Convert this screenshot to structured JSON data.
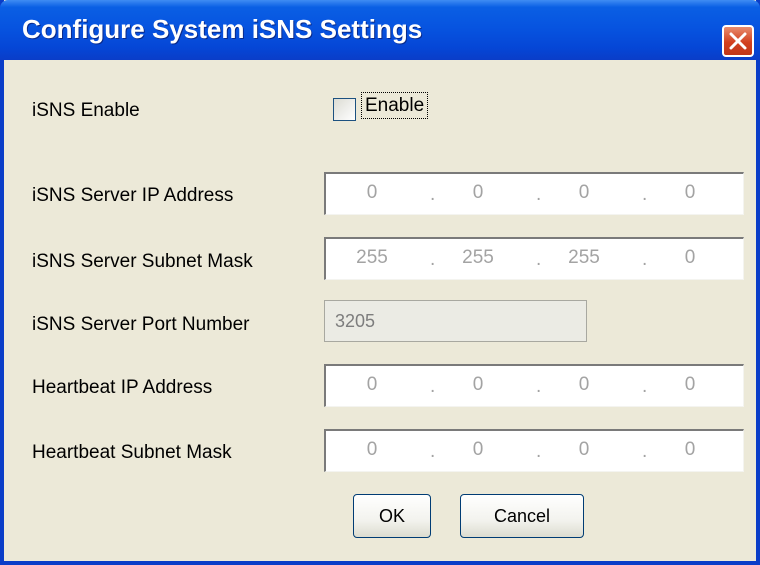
{
  "window": {
    "title": "Configure System iSNS Settings"
  },
  "fields": {
    "isns_enable": {
      "label": "iSNS Enable",
      "checkbox_label": "Enable",
      "checked": false
    },
    "server_ip": {
      "label": "iSNS Server IP Address",
      "octets": [
        "0",
        "0",
        "0",
        "0"
      ]
    },
    "server_mask": {
      "label": "iSNS Server Subnet Mask",
      "octets": [
        "255",
        "255",
        "255",
        "0"
      ]
    },
    "server_port": {
      "label": "iSNS Server Port Number",
      "value": "3205"
    },
    "heartbeat_ip": {
      "label": "Heartbeat IP Address",
      "octets": [
        "0",
        "0",
        "0",
        "0"
      ]
    },
    "heartbeat_mask": {
      "label": "Heartbeat Subnet Mask",
      "octets": [
        "0",
        "0",
        "0",
        "0"
      ]
    }
  },
  "buttons": {
    "ok": "OK",
    "cancel": "Cancel"
  },
  "icons": {
    "close": "close-icon"
  },
  "colors": {
    "titlebar": "#0754e0",
    "close_button": "#d2401f",
    "dialog_background": "#ece9d8"
  }
}
